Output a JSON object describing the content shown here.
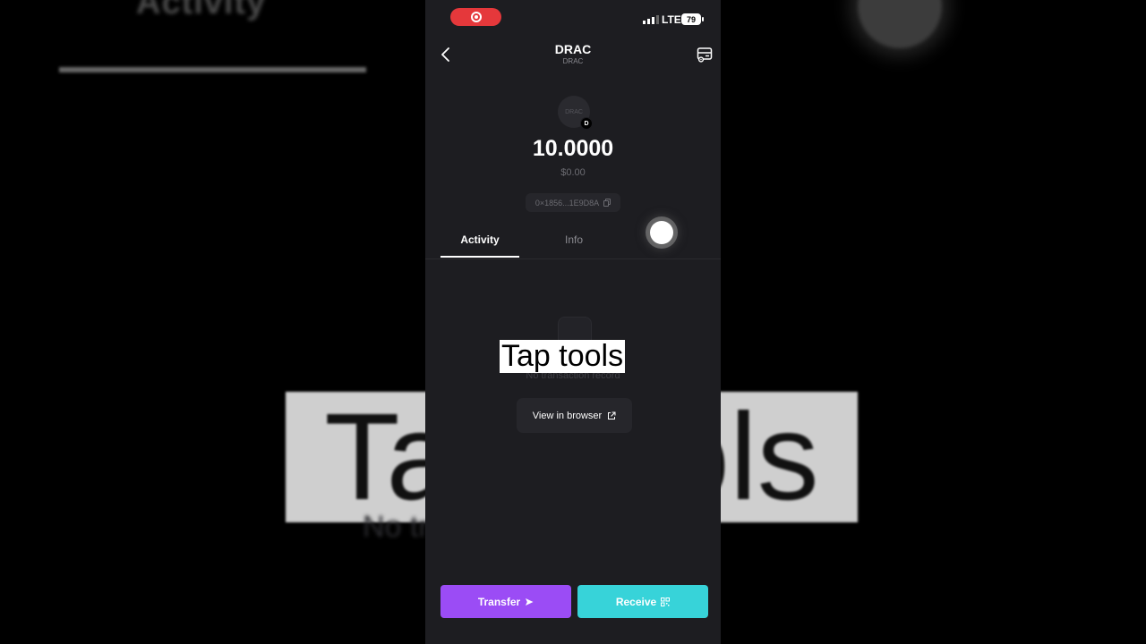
{
  "background": {
    "blurred_tab": "Activity",
    "blurred_caption": "Tap tools",
    "blurred_empty_text": "No transaction record"
  },
  "status_bar": {
    "network": "LTE",
    "battery": "79"
  },
  "header": {
    "title": "DRAC",
    "subtitle": "DRAC"
  },
  "token": {
    "logo_text": "DRAC",
    "chain_badge": "D",
    "balance": "10.0000",
    "fiat_value": "$0.00",
    "address": "0×1856...1E9D8A"
  },
  "tabs": [
    {
      "label": "Activity",
      "active": true
    },
    {
      "label": "Info",
      "active": false
    }
  ],
  "activity": {
    "empty_text": "No transaction record",
    "view_in_browser": "View in browser"
  },
  "caption": "Tap tools",
  "actions": {
    "transfer": "Transfer",
    "receive": "Receive"
  },
  "colors": {
    "transfer": "#9b4cf5",
    "receive": "#37d3d9",
    "record": "#e5383b",
    "panel": "#1d1d21"
  },
  "icons": {
    "back": "chevron-left-icon",
    "tools": "tools-icon",
    "copy": "copy-icon",
    "external": "external-link-icon",
    "transfer": "send-arrow-icon",
    "receive": "qr-code-icon"
  }
}
